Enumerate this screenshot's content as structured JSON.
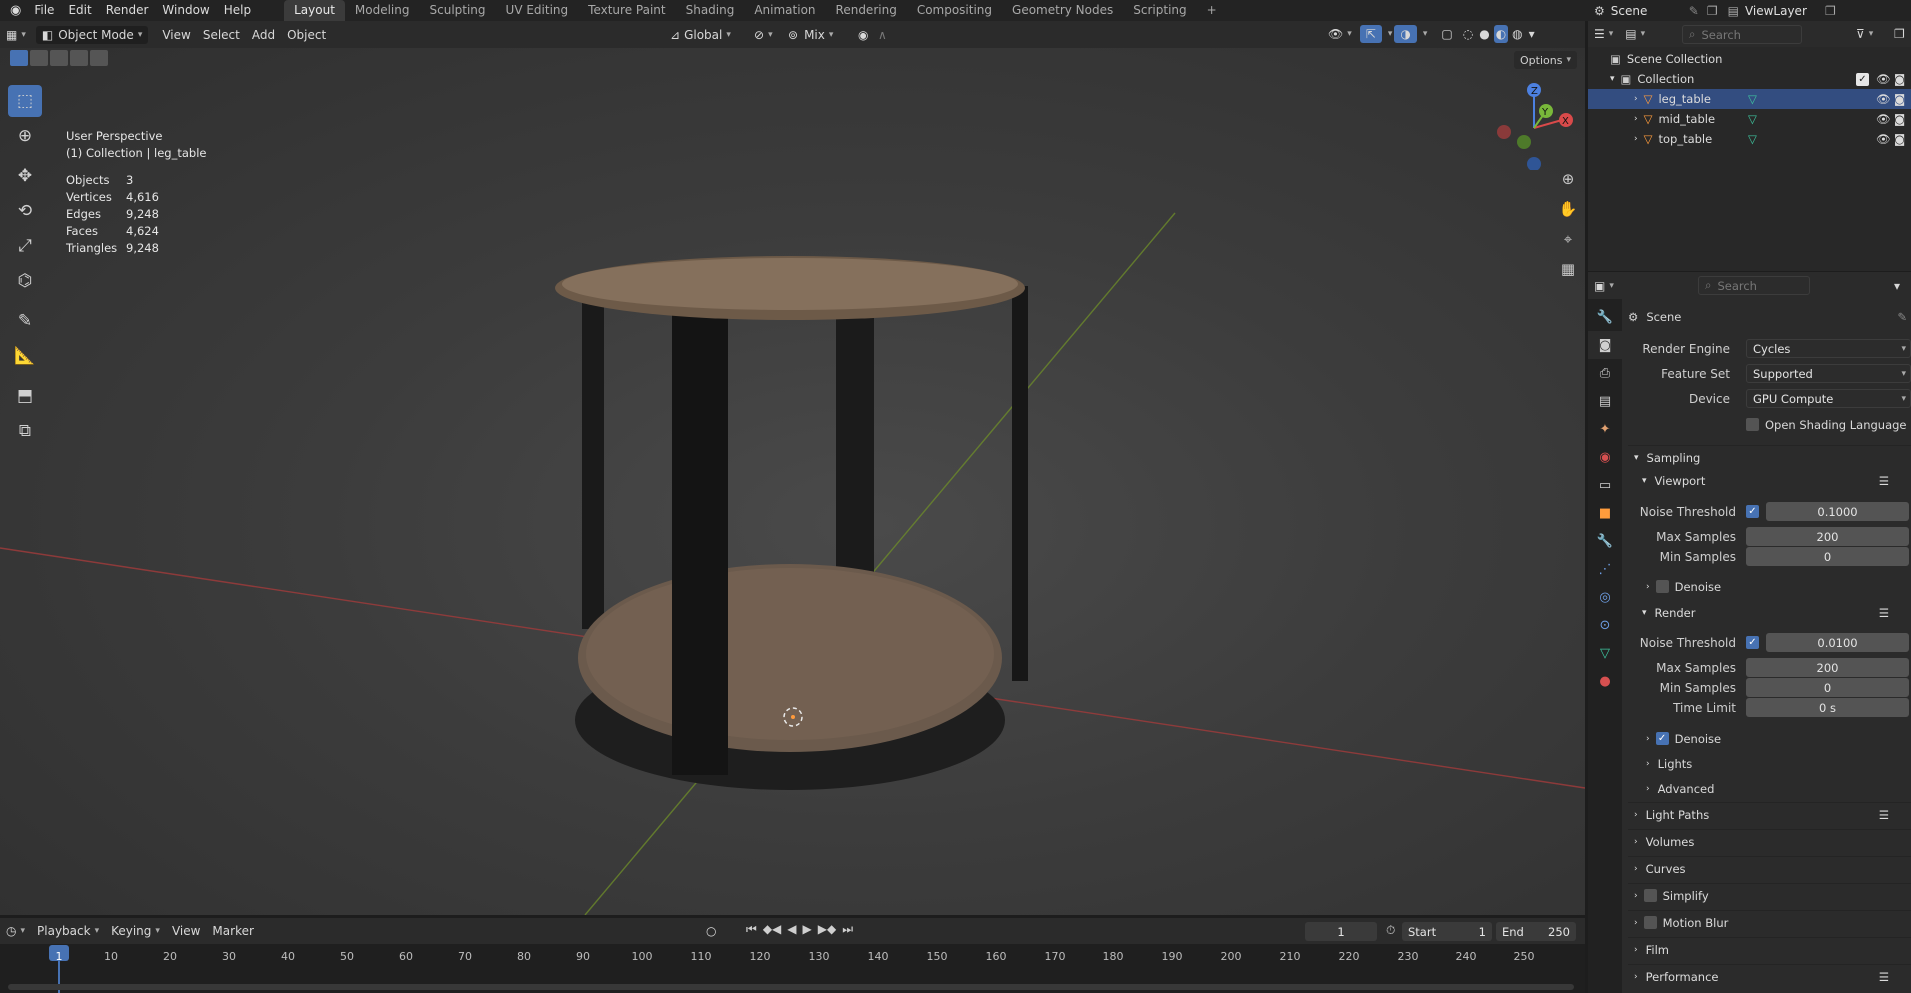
{
  "topbar": {
    "menus": [
      "File",
      "Edit",
      "Render",
      "Window",
      "Help"
    ],
    "workspaces": [
      "Layout",
      "Modeling",
      "Sculpting",
      "UV Editing",
      "Texture Paint",
      "Shading",
      "Animation",
      "Rendering",
      "Compositing",
      "Geometry Nodes",
      "Scripting"
    ],
    "active_workspace": "Layout",
    "add_tab": "+",
    "scene_name": "Scene",
    "view_layer": "ViewLayer"
  },
  "viewport_header": {
    "mode": "Object Mode",
    "menus": [
      "View",
      "Select",
      "Add",
      "Object"
    ],
    "transform_orientation": "Global",
    "snap_mix": "Mix",
    "options": "Options"
  },
  "overlay": {
    "view_name": "User Perspective",
    "active_object": "(1) Collection | leg_table",
    "stats": [
      {
        "label": "Objects",
        "value": "3"
      },
      {
        "label": "Vertices",
        "value": "4,616"
      },
      {
        "label": "Edges",
        "value": "9,248"
      },
      {
        "label": "Faces",
        "value": "4,624"
      },
      {
        "label": "Triangles",
        "value": "9,248"
      }
    ]
  },
  "gizmo": {
    "x": "X",
    "y": "Y",
    "z": "Z"
  },
  "outliner": {
    "search_placeholder": "Search",
    "scene_collection": "Scene Collection",
    "collection": "Collection",
    "objects": [
      "leg_table",
      "mid_table",
      "top_table"
    ],
    "selected": "leg_table"
  },
  "properties": {
    "search_placeholder": "Search",
    "context": "Scene",
    "render_engine_label": "Render Engine",
    "render_engine": "Cycles",
    "feature_set_label": "Feature Set",
    "feature_set": "Supported",
    "device_label": "Device",
    "device": "GPU Compute",
    "osl_label": "Open Shading Language",
    "sampling": "Sampling",
    "viewport": "Viewport",
    "render": "Render",
    "noise_threshold_label": "Noise Threshold",
    "max_samples_label": "Max Samples",
    "min_samples_label": "Min Samples",
    "time_limit_label": "Time Limit",
    "denoise_label": "Denoise",
    "viewport_noise_threshold": "0.1000",
    "viewport_max_samples": "200",
    "viewport_min_samples": "0",
    "render_noise_threshold": "0.0100",
    "render_max_samples": "200",
    "render_min_samples": "0",
    "render_time_limit": "0 s",
    "lights": "Lights",
    "advanced": "Advanced",
    "sections": [
      "Light Paths",
      "Volumes",
      "Curves",
      "Simplify",
      "Motion Blur",
      "Film",
      "Performance"
    ]
  },
  "timeline": {
    "menus": [
      "Playback",
      "Keying",
      "View",
      "Marker"
    ],
    "current_frame": "1",
    "start_label": "Start",
    "start": "1",
    "end_label": "End",
    "end": "250",
    "ticks": [
      "1",
      "10",
      "20",
      "30",
      "40",
      "50",
      "60",
      "70",
      "80",
      "90",
      "100",
      "110",
      "120",
      "130",
      "140",
      "150",
      "160",
      "170",
      "180",
      "190",
      "200",
      "210",
      "220",
      "230",
      "240",
      "250"
    ]
  }
}
